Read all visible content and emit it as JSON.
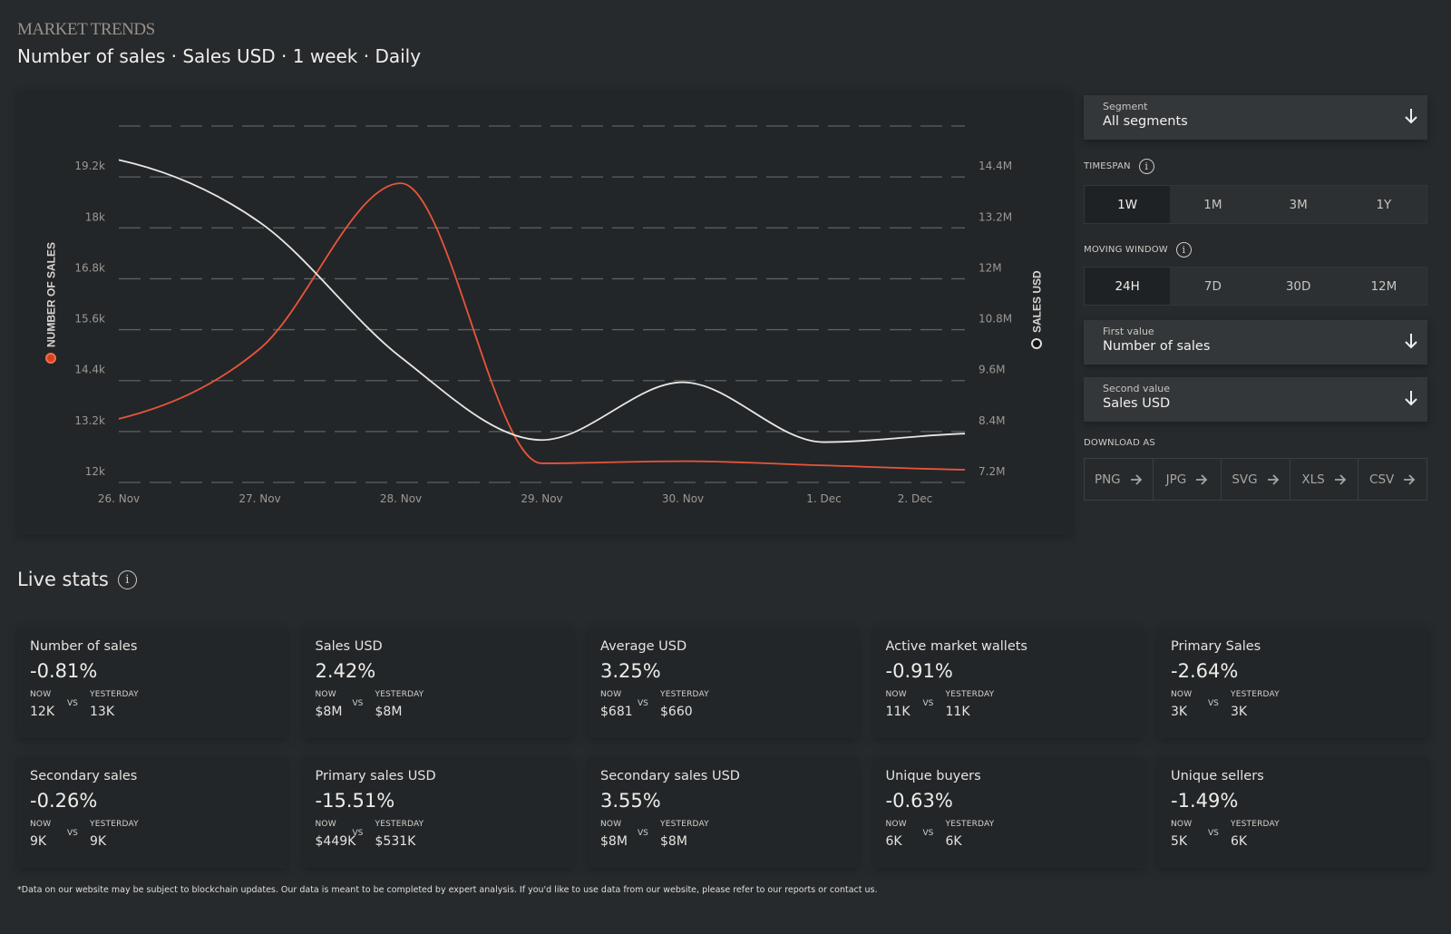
{
  "header": {
    "eyebrow": "MARKET TRENDS",
    "title": "Number of sales · Sales USD · 1 week · Daily"
  },
  "chart_data": {
    "type": "line",
    "x": [
      "26. Nov",
      "27. Nov",
      "28. Nov",
      "29. Nov",
      "30. Nov",
      "1. Dec",
      "2. Dec"
    ],
    "y_left": {
      "label": "NUMBER OF SALES",
      "ticks": [
        "12k",
        "13.2k",
        "14.4k",
        "15.6k",
        "16.8k",
        "18k",
        "19.2k"
      ],
      "range": [
        12000,
        20400
      ]
    },
    "y_right": {
      "label": "SALES USD",
      "ticks": [
        "7.2M",
        "8.4M",
        "9.6M",
        "10.8M",
        "12M",
        "13.2M",
        "14.4M"
      ],
      "range": [
        7200000,
        15600000
      ]
    },
    "grid": true,
    "series": [
      {
        "name": "Number of sales",
        "axis": "left",
        "color": "#e8553a",
        "values": [
          13500,
          15150,
          19050,
          12450,
          12500,
          12400,
          12300
        ]
      },
      {
        "name": "Sales USD",
        "axis": "right",
        "color": "#e8e6e3",
        "values": [
          14800000,
          13330000,
          10150000,
          8200000,
          9560000,
          8150000,
          8350000
        ]
      }
    ]
  },
  "sidebar": {
    "segment": {
      "label": "Segment",
      "value": "All segments"
    },
    "timespan": {
      "label": "TIMESPAN",
      "options": [
        "1W",
        "1M",
        "3M",
        "1Y"
      ],
      "selected": "1W"
    },
    "moving_window": {
      "label": "MOVING WINDOW",
      "options": [
        "24H",
        "7D",
        "30D",
        "12M"
      ],
      "selected": "24H"
    },
    "first_value": {
      "label": "First value",
      "value": "Number of sales"
    },
    "second_value": {
      "label": "Second value",
      "value": "Sales USD"
    },
    "download": {
      "label": "DOWNLOAD AS",
      "formats": [
        "PNG",
        "JPG",
        "SVG",
        "XLS",
        "CSV"
      ]
    }
  },
  "live_stats": {
    "title": "Live stats",
    "now_label": "NOW",
    "yesterday_label": "YESTERDAY",
    "vs_label": "VS",
    "cards": [
      {
        "title": "Number of sales",
        "change": "-0.81%",
        "now": "12K",
        "yesterday": "13K"
      },
      {
        "title": "Sales USD",
        "change": "2.42%",
        "now": "$8M",
        "yesterday": "$8M"
      },
      {
        "title": "Average USD",
        "change": "3.25%",
        "now": "$681",
        "yesterday": "$660"
      },
      {
        "title": "Active market wallets",
        "change": "-0.91%",
        "now": "11K",
        "yesterday": "11K"
      },
      {
        "title": "Primary Sales",
        "change": "-2.64%",
        "now": "3K",
        "yesterday": "3K"
      },
      {
        "title": "Secondary sales",
        "change": "-0.26%",
        "now": "9K",
        "yesterday": "9K"
      },
      {
        "title": "Primary sales USD",
        "change": "-15.51%",
        "now": "$449K",
        "yesterday": "$531K"
      },
      {
        "title": "Secondary sales USD",
        "change": "3.55%",
        "now": "$8M",
        "yesterday": "$8M"
      },
      {
        "title": "Unique buyers",
        "change": "-0.63%",
        "now": "6K",
        "yesterday": "6K"
      },
      {
        "title": "Unique sellers",
        "change": "-1.49%",
        "now": "5K",
        "yesterday": "6K"
      }
    ]
  },
  "footnote": "*Data on our website may be subject to blockchain updates. Our data is meant to be completed by expert analysis. If you'd like to use data from our website, please refer to our reports or contact us."
}
